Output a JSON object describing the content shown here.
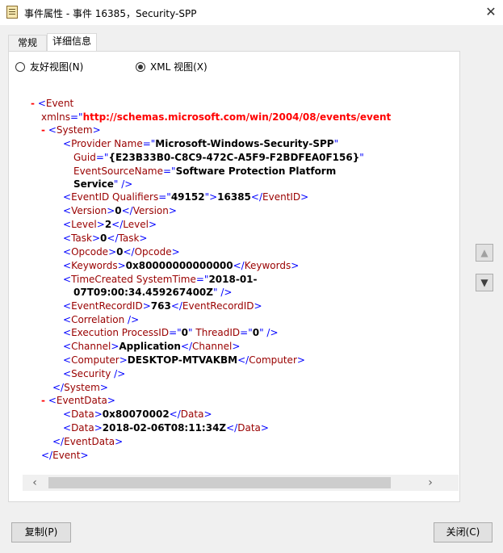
{
  "window": {
    "title": "事件属性 - 事件 16385，Security-SPP",
    "close_glyph": "✕"
  },
  "tabs": [
    {
      "label": "常规"
    },
    {
      "label": "详细信息"
    }
  ],
  "view_options": [
    {
      "label": "友好视图(N)",
      "selected": false
    },
    {
      "label": "XML 视图(X)",
      "selected": true
    }
  ],
  "xml": {
    "l1_tag": "Event",
    "l2_attr": "xmlns",
    "l2_val": "http://schemas.microsoft.com/win/2004/08/events/event",
    "l3_tag": "System",
    "l4_tag": "Provider",
    "l4_attr": "Name",
    "l4_val": "Microsoft-Windows-Security-SPP",
    "l5_attr": "Guid",
    "l5_val": "{E23B33B0-C8C9-472C-A5F9-F2BDFEA0F156}",
    "l6_attr": "EventSourceName",
    "l6_val": "Software Protection Platform",
    "l7_val": "Service",
    "l8_tag": "EventID",
    "l8_attr": "Qualifiers",
    "l8_val": "49152",
    "l8_text": "16385",
    "l9_tag": "Version",
    "l9_text": "0",
    "l10_tag": "Level",
    "l10_text": "2",
    "l11_tag": "Task",
    "l11_text": "0",
    "l12_tag": "Opcode",
    "l12_text": "0",
    "l13_tag": "Keywords",
    "l13_text": "0x80000000000000",
    "l14_tag": "TimeCreated",
    "l14_attr": "SystemTime",
    "l14_val": "2018-01-",
    "l15_val": "07T09:00:34.459267400Z",
    "l16_tag": "EventRecordID",
    "l16_text": "763",
    "l17_tag": "Correlation",
    "l18_tag": "Execution",
    "l18_attr1": "ProcessID",
    "l18_val1": "0",
    "l18_attr2": "ThreadID",
    "l18_val2": "0",
    "l19_tag": "Channel",
    "l19_text": "Application",
    "l20_tag": "Computer",
    "l20_text": "DESKTOP-MTVAKBM",
    "l21_tag": "Security",
    "l22_tag": "System",
    "l23_tag": "EventData",
    "l24_tag": "Data",
    "l24_text": "0x80070002",
    "l25_tag": "Data",
    "l25_text": "2018-02-06T08:11:34Z",
    "l26_tag": "EventData",
    "l27_tag": "Event"
  },
  "scrollbar": {
    "left_arrow": "‹",
    "right_arrow": "›"
  },
  "side_buttons": {
    "up_glyph": "▲",
    "down_glyph": "▼"
  },
  "buttons": {
    "copy": "复制(P)",
    "close": "关闭(C)"
  }
}
